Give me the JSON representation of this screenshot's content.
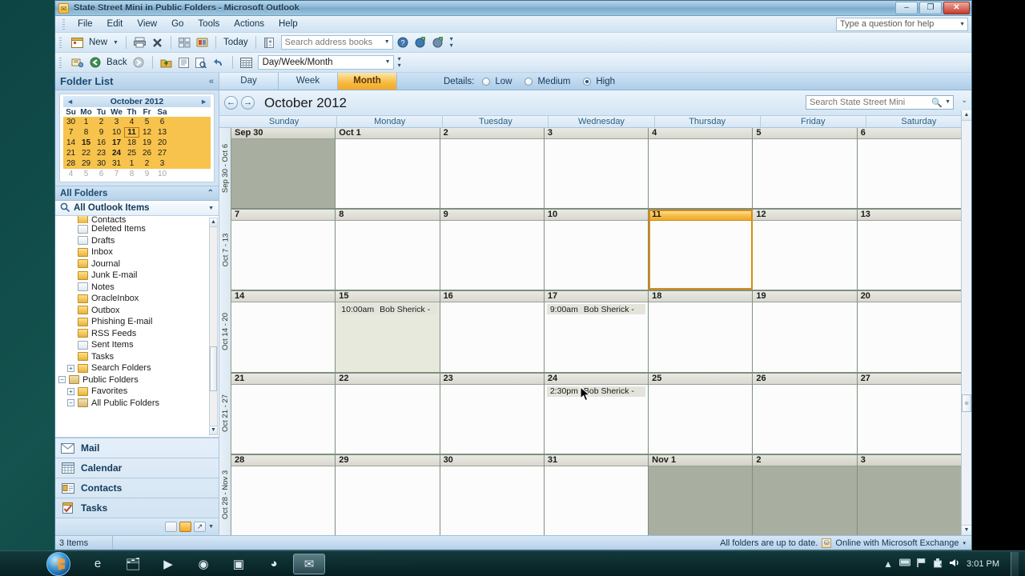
{
  "window": {
    "title": "State Street Mini in Public Folders - Microsoft Outlook",
    "minimize": "–",
    "maximize": "❐",
    "close": "✕"
  },
  "menu": {
    "items": [
      "File",
      "Edit",
      "View",
      "Go",
      "Tools",
      "Actions",
      "Help"
    ],
    "help_placeholder": "Type a question for help"
  },
  "toolbar1": {
    "new_label": "New",
    "today_label": "Today",
    "address_placeholder": "Search address books",
    "icons": [
      "new-appointment-icon",
      "print-icon",
      "delete-icon",
      "view-grid-icon",
      "categorize-icon",
      "address-book-icon",
      "help-icon",
      "forward-icon",
      "next-icon"
    ]
  },
  "toolbar2": {
    "back_label": "Back",
    "view_value": "Day/Week/Month",
    "icons": [
      "rules-icon",
      "back-icon",
      "forward-icon",
      "folder-up-icon",
      "reading-pane-icon",
      "print-preview-icon",
      "undo-icon",
      "calendar-view-icon"
    ]
  },
  "nav": {
    "header": "Folder List",
    "collapse_icon": "«",
    "minical": {
      "month": "October 2012",
      "prev": "◄",
      "next": "►",
      "dow": [
        "Su",
        "Mo",
        "Tu",
        "We",
        "Th",
        "Fr",
        "Sa"
      ],
      "weeks": [
        [
          {
            "d": "30"
          },
          {
            "d": "1"
          },
          {
            "d": "2"
          },
          {
            "d": "3"
          },
          {
            "d": "4"
          },
          {
            "d": "5"
          },
          {
            "d": "6"
          }
        ],
        [
          {
            "d": "7"
          },
          {
            "d": "8"
          },
          {
            "d": "9"
          },
          {
            "d": "10"
          },
          {
            "d": "11",
            "today": true
          },
          {
            "d": "12"
          },
          {
            "d": "13"
          }
        ],
        [
          {
            "d": "14"
          },
          {
            "d": "15",
            "bold": true
          },
          {
            "d": "16"
          },
          {
            "d": "17",
            "bold": true
          },
          {
            "d": "18"
          },
          {
            "d": "19"
          },
          {
            "d": "20"
          }
        ],
        [
          {
            "d": "21"
          },
          {
            "d": "22"
          },
          {
            "d": "23"
          },
          {
            "d": "24",
            "bold": true
          },
          {
            "d": "25"
          },
          {
            "d": "26"
          },
          {
            "d": "27"
          }
        ],
        [
          {
            "d": "28"
          },
          {
            "d": "29"
          },
          {
            "d": "30"
          },
          {
            "d": "31"
          },
          {
            "d": "1"
          },
          {
            "d": "2"
          },
          {
            "d": "3"
          }
        ]
      ],
      "trailing": [
        "4",
        "5",
        "6",
        "7",
        "8",
        "9",
        "10"
      ]
    },
    "all_folders_header": "All Folders",
    "all_folders_chevron": "⌃",
    "all_outlook_items": "All Outlook Items",
    "tree": [
      {
        "label": "Contacts",
        "icon": "contacts-folder-icon",
        "indent": 1,
        "clipped": true
      },
      {
        "label": "Deleted Items",
        "icon": "deleted-items-folder-icon",
        "indent": 1
      },
      {
        "label": "Drafts",
        "icon": "drafts-folder-icon",
        "indent": 1
      },
      {
        "label": "Inbox",
        "icon": "inbox-folder-icon",
        "indent": 1
      },
      {
        "label": "Journal",
        "icon": "journal-folder-icon",
        "indent": 1
      },
      {
        "label": "Junk E-mail",
        "icon": "junk-email-folder-icon",
        "indent": 1
      },
      {
        "label": "Notes",
        "icon": "notes-folder-icon",
        "indent": 1
      },
      {
        "label": "OracleInbox",
        "icon": "folder-icon",
        "indent": 1
      },
      {
        "label": "Outbox",
        "icon": "outbox-folder-icon",
        "indent": 1
      },
      {
        "label": "Phishing E-mail",
        "icon": "folder-icon",
        "indent": 1
      },
      {
        "label": "RSS Feeds",
        "icon": "rss-feeds-folder-icon",
        "indent": 1
      },
      {
        "label": "Sent Items",
        "icon": "sent-items-folder-icon",
        "indent": 1
      },
      {
        "label": "Tasks",
        "icon": "tasks-folder-icon",
        "indent": 1
      },
      {
        "label": "Search Folders",
        "icon": "search-folder-icon",
        "indent": 1,
        "expand": "+"
      },
      {
        "label": "Public Folders",
        "icon": "public-folders-icon",
        "indent": 0,
        "expand": "−"
      },
      {
        "label": "Favorites",
        "icon": "favorites-folder-icon",
        "indent": 1,
        "expand": "+"
      },
      {
        "label": "All Public Folders",
        "icon": "public-folders-icon",
        "indent": 1,
        "expand": "−"
      }
    ],
    "buttons": [
      {
        "label": "Mail",
        "icon": "mail-icon"
      },
      {
        "label": "Calendar",
        "icon": "calendar-icon"
      },
      {
        "label": "Contacts",
        "icon": "contacts-icon"
      },
      {
        "label": "Tasks",
        "icon": "tasks-icon"
      }
    ],
    "footer_icons": [
      "notes-small-icon",
      "folder-list-small-icon",
      "shortcuts-small-icon",
      "configure-chevron-icon"
    ]
  },
  "view": {
    "tabs": [
      {
        "label": "Day",
        "active": false
      },
      {
        "label": "Week",
        "active": false
      },
      {
        "label": "Month",
        "active": true
      }
    ],
    "details_label": "Details:",
    "detail_options": [
      {
        "label": "Low",
        "selected": false
      },
      {
        "label": "Medium",
        "selected": false
      },
      {
        "label": "High",
        "selected": true
      }
    ]
  },
  "calendar": {
    "title": "October 2012",
    "prev_icon": "←",
    "next_icon": "→",
    "search_placeholder": "Search State Street Mini",
    "search_value": "",
    "day_headers": [
      "Sunday",
      "Monday",
      "Tuesday",
      "Wednesday",
      "Thursday",
      "Friday",
      "Saturday"
    ],
    "weeks": [
      {
        "label": "Sep 30 - Oct 6",
        "days": [
          {
            "num": "Sep 30",
            "out": true,
            "appts": []
          },
          {
            "num": "Oct 1",
            "appts": []
          },
          {
            "num": "2",
            "appts": []
          },
          {
            "num": "3",
            "appts": []
          },
          {
            "num": "4",
            "appts": []
          },
          {
            "num": "5",
            "appts": []
          },
          {
            "num": "6",
            "appts": []
          }
        ]
      },
      {
        "label": "Oct 7 - 13",
        "days": [
          {
            "num": "7",
            "appts": []
          },
          {
            "num": "8",
            "appts": []
          },
          {
            "num": "9",
            "appts": []
          },
          {
            "num": "10",
            "appts": []
          },
          {
            "num": "11",
            "today": true,
            "appts": []
          },
          {
            "num": "12",
            "appts": []
          },
          {
            "num": "13",
            "appts": []
          }
        ]
      },
      {
        "label": "Oct 14 - 20",
        "days": [
          {
            "num": "14",
            "appts": []
          },
          {
            "num": "15",
            "selected": true,
            "appts": [
              {
                "time": "10:00am",
                "subject": "Bob Sherick -"
              }
            ]
          },
          {
            "num": "16",
            "appts": []
          },
          {
            "num": "17",
            "appts": [
              {
                "time": "9:00am",
                "subject": "Bob Sherick -"
              }
            ]
          },
          {
            "num": "18",
            "appts": []
          },
          {
            "num": "19",
            "appts": []
          },
          {
            "num": "20",
            "appts": []
          }
        ]
      },
      {
        "label": "Oct 21 - 27",
        "days": [
          {
            "num": "21",
            "appts": []
          },
          {
            "num": "22",
            "appts": []
          },
          {
            "num": "23",
            "appts": []
          },
          {
            "num": "24",
            "appts": [
              {
                "time": "2:30pm",
                "subject": "Bob Sherick -"
              }
            ]
          },
          {
            "num": "25",
            "appts": []
          },
          {
            "num": "26",
            "appts": []
          },
          {
            "num": "27",
            "appts": []
          }
        ]
      },
      {
        "label": "Oct 28 - Nov 3",
        "days": [
          {
            "num": "28",
            "appts": []
          },
          {
            "num": "29",
            "appts": []
          },
          {
            "num": "30",
            "appts": []
          },
          {
            "num": "31",
            "appts": []
          },
          {
            "num": "Nov 1",
            "out": true,
            "appts": []
          },
          {
            "num": "2",
            "out": true,
            "appts": []
          },
          {
            "num": "3",
            "out": true,
            "appts": []
          }
        ]
      }
    ]
  },
  "status": {
    "items": "3 Items",
    "sync": "All folders are up to date.",
    "connection": "Online with Microsoft Exchange",
    "connection_caret": "▾"
  },
  "taskbar": {
    "start_icon": "windows-start-icon",
    "items": [
      {
        "icon": "internet-explorer-icon",
        "glyph": "e",
        "active": false
      },
      {
        "icon": "windows-explorer-icon",
        "glyph": "🗂",
        "active": false
      },
      {
        "icon": "media-player-icon",
        "glyph": "▶",
        "active": false
      },
      {
        "icon": "chrome-icon",
        "glyph": "◉",
        "active": false
      },
      {
        "icon": "camera-icon",
        "glyph": "▣",
        "active": false
      },
      {
        "icon": "firefox-icon",
        "glyph": "◕",
        "active": false
      },
      {
        "icon": "outlook-icon",
        "glyph": "✉",
        "active": true
      }
    ],
    "tray_icons": [
      "show-hidden-icons-chevron",
      "network-icon",
      "action-center-flag-icon",
      "safely-remove-icon",
      "volume-icon"
    ],
    "clock": "3:01 PM"
  },
  "colors": {
    "accent_orange": "#f2aa2a",
    "title_blue": "#1b3c54",
    "nav_blue": "#d3e3f2",
    "out_of_month": "#a8aea0",
    "grid_line": "#7f8f7f"
  }
}
